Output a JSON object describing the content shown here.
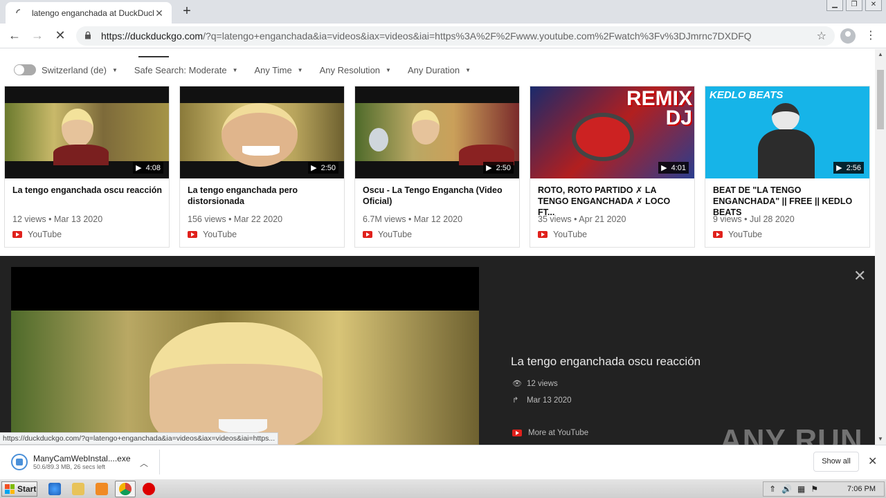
{
  "browser": {
    "tab_title": "latengo enganchada at DuckDuckGo",
    "url_host": "https://duckduckgo.com",
    "url_rest": "/?q=latengo+enganchada&ia=videos&iax=videos&iai=https%3A%2F%2Fwww.youtube.com%2Fwatch%3Fv%3DJmrnc7DXDFQ",
    "status_url": "https://duckduckgo.com/?q=latengo+enganchada&ia=videos&iax=videos&iai=https..."
  },
  "filters": [
    {
      "label": "Switzerland (de)"
    },
    {
      "label": "Safe Search: Moderate"
    },
    {
      "label": "Any Time"
    },
    {
      "label": "Any Resolution"
    },
    {
      "label": "Any Duration"
    }
  ],
  "results": [
    {
      "title": "La tengo enganchada oscu reacción",
      "views": "12 views",
      "date": "Mar 13 2020",
      "duration": "4:08",
      "source": "YouTube"
    },
    {
      "title": "La tengo enganchada pero distorsionada",
      "views": "156 views",
      "date": "Mar 22 2020",
      "duration": "2:50",
      "source": "YouTube"
    },
    {
      "title": "Oscu - La Tengo Engancha (Video Oficial)",
      "views": "6.7M views",
      "date": "Mar 12 2020",
      "duration": "2:50",
      "source": "YouTube"
    },
    {
      "title": "ROTO, ROTO PARTIDO ✗ LA TENGO ENGANCHADA ✗ LOCO FT...",
      "views": "35 views",
      "date": "Apr 21 2020",
      "duration": "4:01",
      "source": "YouTube",
      "overlay": "REMIX\nDJ"
    },
    {
      "title": "BEAT DE \"LA TENGO ENGANCHADA\" || FREE || KEDLO BEATS",
      "views": "9 views",
      "date": "Jul 28 2020",
      "duration": "2:56",
      "source": "YouTube",
      "overlay": "KEDLO BEATS"
    }
  ],
  "detail": {
    "title": "La tengo enganchada oscu reacción",
    "views": "12 views",
    "date": "Mar 13 2020",
    "more": "More at YouTube"
  },
  "download": {
    "filename": "ManyCamWebInstal....exe",
    "progress": "50.6/89.3 MB, 26 secs left",
    "show_all": "Show all"
  },
  "taskbar": {
    "start": "Start",
    "time": "7:06 PM"
  },
  "watermark": "ANY RUN",
  "colors": {
    "youtube_red": "#e0211c",
    "detail_bg": "#222222"
  }
}
